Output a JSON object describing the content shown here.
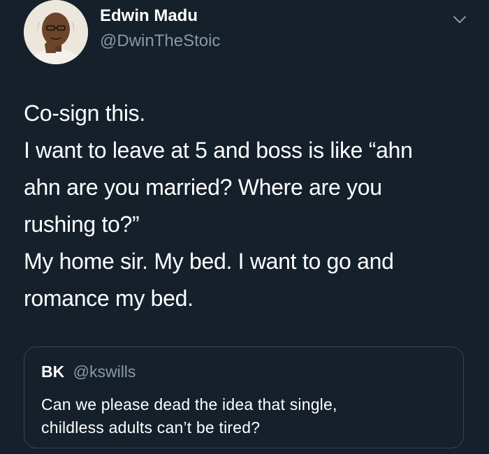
{
  "author": {
    "name": "Edwin Madu",
    "handle": "@DwinTheStoic",
    "avatar_icon": "profile-photo"
  },
  "menu_icon": "chevron-down-icon",
  "tweet": {
    "lines": [
      "Co-sign this.",
      "I want to leave at 5 and boss is like “ahn",
      "ahn are you married? Where are you",
      "rushing to?”",
      "My home sir. My bed. I want to go and",
      "romance my bed."
    ]
  },
  "quoted_tweet": {
    "name": "BK",
    "handle": "@kswills",
    "lines": [
      "Can we please dead the idea that single,",
      "childless adults can’t be tired?"
    ]
  },
  "colors": {
    "background": "#15202b",
    "text": "#ffffff",
    "secondary_text": "#8899a6",
    "border": "#38444d"
  }
}
